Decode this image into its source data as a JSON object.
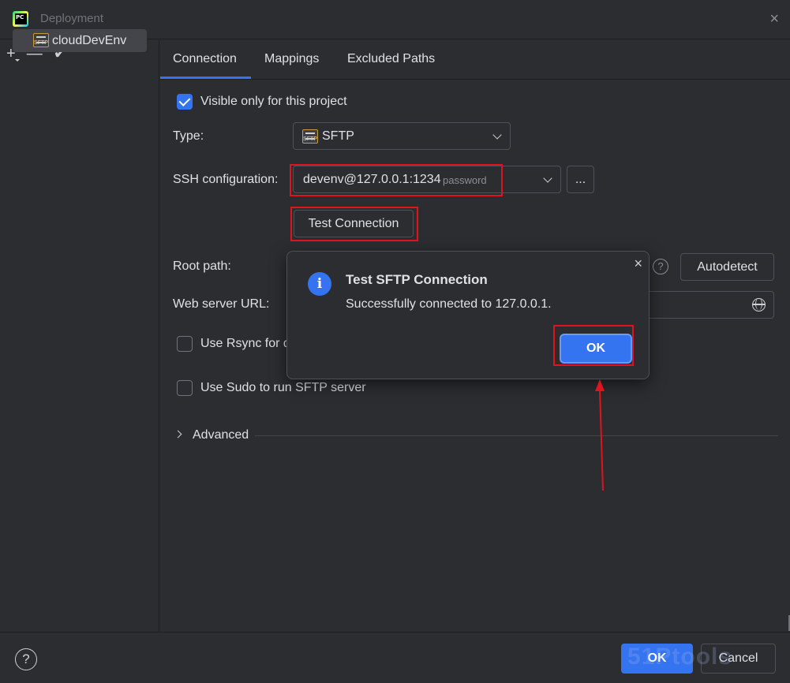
{
  "window": {
    "title": "Deployment",
    "close_glyph": "×"
  },
  "left_pane": {
    "toolbar": {
      "add": "+",
      "remove": "—",
      "apply": "✔"
    },
    "servers": [
      {
        "name": "cloudDevEnv",
        "icon": "sftp-server-icon"
      }
    ]
  },
  "tabs": [
    {
      "label": "Connection",
      "active": true
    },
    {
      "label": "Mappings",
      "active": false
    },
    {
      "label": "Excluded Paths",
      "active": false
    }
  ],
  "form": {
    "visible_only": {
      "label": "Visible only for this project",
      "checked": true
    },
    "type": {
      "label": "Type:",
      "value": "SFTP",
      "icon": "sftp-icon"
    },
    "ssh": {
      "label": "SSH configuration:",
      "value": "devenv@127.0.0.1:1234",
      "hint": "password",
      "browse_label": "..."
    },
    "test_connection_label": "Test Connection",
    "root_path": {
      "label": "Root path:",
      "help": "?",
      "autodetect_label": "Autodetect"
    },
    "web_server_url": {
      "label": "Web server URL:"
    },
    "use_rsync": {
      "label": "Use Rsync for d",
      "checked": false
    },
    "use_sudo": {
      "label": "Use Sudo to run SFTP server",
      "checked": false
    },
    "advanced_label": "Advanced"
  },
  "popup": {
    "title": "Test SFTP Connection",
    "message": "Successfully connected to 127.0.0.1.",
    "ok_label": "OK",
    "close_glyph": "×",
    "info_glyph": "i"
  },
  "footer": {
    "help": "?",
    "ok_label": "OK",
    "cancel_label": "Cancel",
    "watermark": "51Ptools"
  },
  "colors": {
    "accent": "#3574f0",
    "annotation": "#e0141e",
    "background": "#2b2d30"
  }
}
